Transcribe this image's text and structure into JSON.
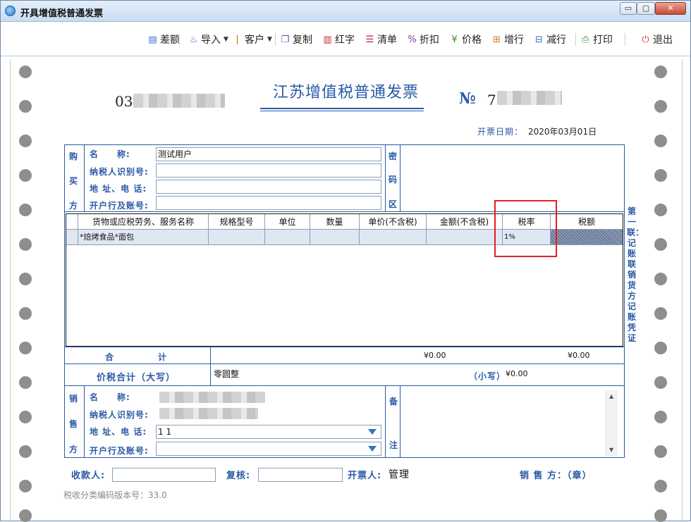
{
  "window": {
    "title": "开具增值税普通发票",
    "min_glyph": "▭",
    "max_glyph": "▢",
    "close_glyph": "✕"
  },
  "toolbar": {
    "items": [
      {
        "label": "差额",
        "icon": "difference-icon",
        "glyph": "▤"
      },
      {
        "label": "导入",
        "icon": "import-icon",
        "glyph": "♨"
      },
      {
        "label": "客户",
        "icon": "customer-icon",
        "glyph": "ǀ"
      },
      {
        "label": "复制",
        "icon": "copy-icon",
        "glyph": "❐"
      },
      {
        "label": "红字",
        "icon": "red-letter-icon",
        "glyph": "▥"
      },
      {
        "label": "清单",
        "icon": "list-icon",
        "glyph": "☰"
      },
      {
        "label": "折扣",
        "icon": "discount-icon",
        "glyph": "%"
      },
      {
        "label": "价格",
        "icon": "price-icon",
        "glyph": "¥"
      },
      {
        "label": "增行",
        "icon": "add-row-icon",
        "glyph": "⊞"
      },
      {
        "label": "减行",
        "icon": "remove-row-icon",
        "glyph": "⊟"
      },
      {
        "label": "打印",
        "icon": "print-icon",
        "glyph": "⎙"
      },
      {
        "label": "退出",
        "icon": "exit-icon",
        "glyph": "⏻"
      }
    ],
    "dropdown_arrow": "▼"
  },
  "invoice": {
    "code_prefix": "03",
    "title": "江苏增值税普通发票",
    "number_symbol": "№",
    "number_prefix": "7",
    "date_label": "开票日期：",
    "date_value": "2020年03月01日"
  },
  "buyer": {
    "side_label": [
      "购",
      "买",
      "方"
    ],
    "name_label": "名　　称:",
    "name_value": "测试用户",
    "tax_id_label": "纳税人识别号:",
    "tax_id_value": "",
    "address_label": "地 址、电 话:",
    "address_value": "",
    "bank_label": "开户行及账号:",
    "bank_value": ""
  },
  "cipher": {
    "side_label": [
      "密",
      "码",
      "区"
    ]
  },
  "goods": {
    "headers": [
      "货物或应税劳务、服务名称",
      "规格型号",
      "单位",
      "数量",
      "单价(不含税)",
      "金额(不含税)",
      "税率",
      "税额"
    ],
    "rows": [
      [
        "*焙烤食品*面包",
        "",
        "",
        "",
        "",
        "",
        "1%",
        ""
      ]
    ]
  },
  "totals": {
    "label": "合　　　　计",
    "amount": "¥0.00",
    "tax": "¥0.00",
    "grand_label": "价税合计（大写）",
    "grand_words": "零圆整",
    "small_label": "（小写）",
    "small_value": "¥0.00"
  },
  "seller": {
    "side_label": [
      "销",
      "售",
      "方"
    ],
    "name_label": "名　　称:",
    "tax_id_label": "纳税人识别号:",
    "address_label": "地 址、电 话:",
    "address_value": "1 1",
    "bank_label": "开户行及账号:",
    "bank_value": ""
  },
  "remarks": {
    "side_label": [
      "备",
      "注"
    ],
    "scroll_up": "▲",
    "scroll_down": "▼"
  },
  "side_note": "第一联：记账联　销货方记账凭证",
  "footer": {
    "payee_label": "收款人:",
    "reviewer_label": "复核:",
    "issuer_label": "开票人:",
    "issuer_value": "管理",
    "seller_stamp": "销 售 方：（章）",
    "version": "税收分类编码版本号：33.0"
  },
  "colors": {
    "form_blue": "#2a5aa6",
    "highlight_red": "#e02020",
    "selected_cell": "#6f7f9c"
  }
}
